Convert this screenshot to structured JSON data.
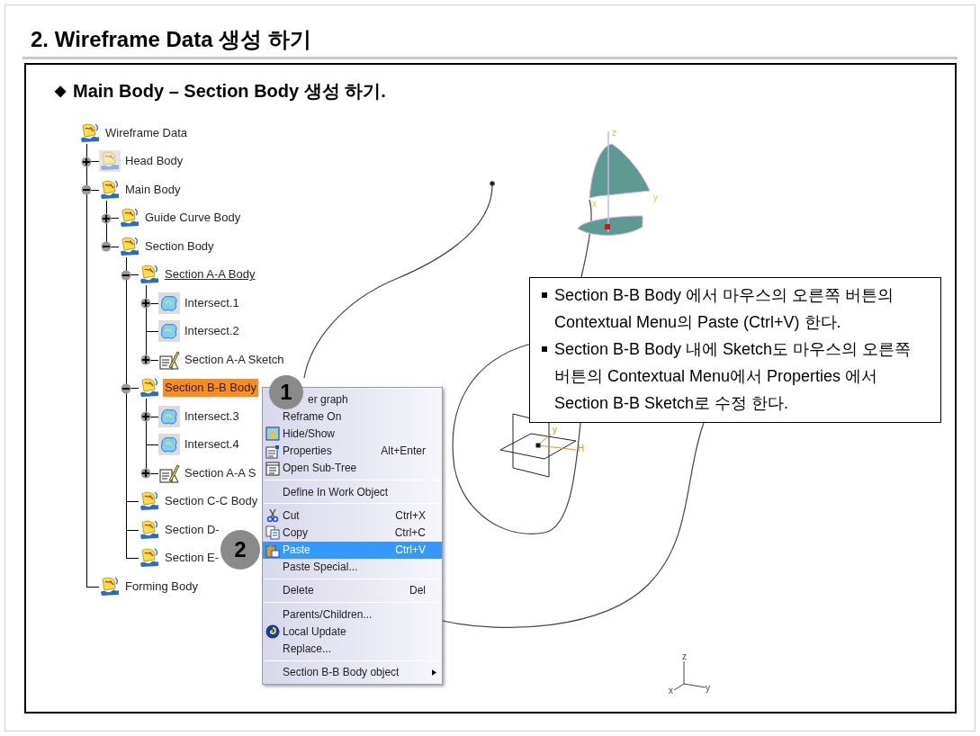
{
  "title": "2. Wireframe Data 생성 하기",
  "subtitle": {
    "bullet": "◆",
    "text": "Main Body – Section Body 생성 하기."
  },
  "tree": {
    "label": "Wireframe Data",
    "kind": "body",
    "selected": false,
    "in_work": false,
    "children": [
      {
        "label": "Head Body",
        "kind": "hidden_body",
        "expanded": false,
        "selected": false,
        "in_work": false
      },
      {
        "label": "Main Body",
        "kind": "body",
        "expanded": true,
        "selected": false,
        "in_work": false,
        "children": [
          {
            "label": "Guide Curve Body",
            "kind": "body",
            "expanded": false,
            "selected": false,
            "in_work": false
          },
          {
            "label": "Section Body",
            "kind": "body",
            "expanded": true,
            "selected": false,
            "in_work": false,
            "children": [
              {
                "label": "Section A-A Body",
                "kind": "body",
                "expanded": true,
                "selected": false,
                "in_work": true,
                "children": [
                  {
                    "label": "Intersect.1",
                    "kind": "intersect",
                    "expanded": false,
                    "selected": false,
                    "in_work": false
                  },
                  {
                    "label": "Intersect.2",
                    "kind": "intersect",
                    "selected": false,
                    "in_work": false
                  },
                  {
                    "label": "Section A-A Sketch",
                    "kind": "sketch",
                    "expanded": false,
                    "selected": false,
                    "in_work": false
                  }
                ]
              },
              {
                "label": "Section B-B Body",
                "kind": "body",
                "expanded": true,
                "selected": true,
                "in_work": false,
                "children": [
                  {
                    "label": "Intersect.3",
                    "kind": "intersect",
                    "expanded": false,
                    "selected": false,
                    "in_work": false
                  },
                  {
                    "label": "Intersect.4",
                    "kind": "intersect",
                    "selected": false,
                    "in_work": false
                  },
                  {
                    "label": "Section A-A S",
                    "kind": "sketch",
                    "expanded": false,
                    "selected": false,
                    "in_work": false
                  }
                ]
              },
              {
                "label": "Section C-C Body",
                "kind": "body",
                "selected": false,
                "in_work": false
              },
              {
                "label": "Section D-",
                "kind": "body",
                "selected": false,
                "in_work": false
              },
              {
                "label": "Section E-",
                "kind": "body",
                "selected": false,
                "in_work": false
              }
            ]
          }
        ]
      },
      {
        "label": "Forming Body",
        "kind": "body",
        "selected": false,
        "in_work": false
      }
    ]
  },
  "context_menu": {
    "groups": [
      [
        {
          "label": "er graph",
          "selected": false
        },
        {
          "label": "Reframe On",
          "selected": false
        },
        {
          "label": "Hide/Show",
          "selected": false
        },
        {
          "label": "Properties",
          "shortcut": "Alt+Enter",
          "selected": false
        },
        {
          "label": "Open Sub-Tree",
          "selected": false
        }
      ],
      [
        {
          "label": "Define In Work Object",
          "selected": false
        }
      ],
      [
        {
          "label": "Cut",
          "shortcut": "Ctrl+X",
          "selected": false
        },
        {
          "label": "Copy",
          "shortcut": "Ctrl+C",
          "selected": false
        },
        {
          "label": "Paste",
          "shortcut": "Ctrl+V",
          "selected": true
        },
        {
          "label": "Paste Special...",
          "selected": false
        }
      ],
      [
        {
          "label": "Delete",
          "shortcut": "Del",
          "selected": false
        }
      ],
      [
        {
          "label": "Parents/Children...",
          "selected": false
        },
        {
          "label": "Local Update",
          "selected": false
        },
        {
          "label": "Replace...",
          "selected": false
        }
      ],
      [
        {
          "label": "Section B-B Body object",
          "submenu": true,
          "selected": false
        }
      ]
    ]
  },
  "step_badges": [
    "1",
    "2"
  ],
  "callout": [
    "Section B-B Body 에서 마우스의 오른쪽 버튼의 Contextual Menu의 Paste (Ctrl+V) 한다.",
    "Section B-B Body 내에 Sketch도 마우스의 오른쪽 버튼의 Contextual Menu에서 Properties 에서 Section B-B Sketch로 수정 한다."
  ],
  "viewport": {
    "sketch_axis_labels": [
      "z",
      "x",
      "y"
    ],
    "plane_axis_labels": [
      "y",
      "H"
    ],
    "triad_labels": [
      "z",
      "y",
      "x"
    ]
  }
}
